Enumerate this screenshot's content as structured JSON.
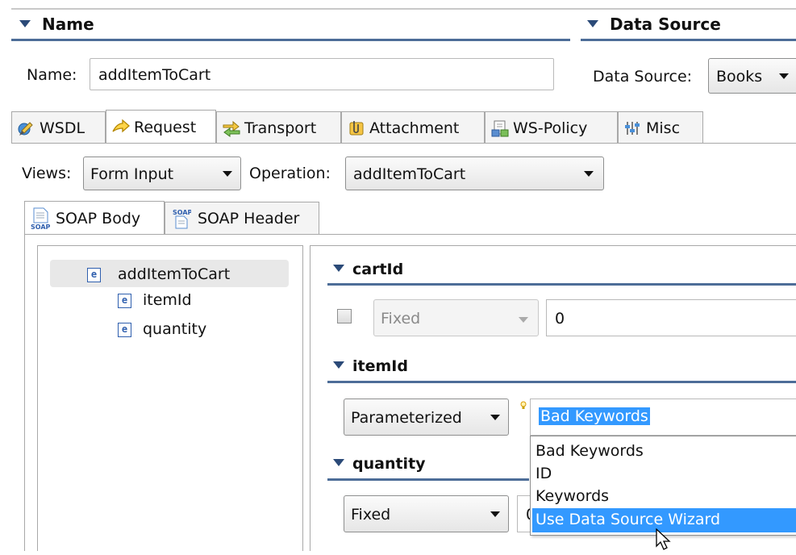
{
  "name_section": {
    "title": "Name",
    "label": "Name:",
    "value": "addItemToCart"
  },
  "datasource_section": {
    "title": "Data Source",
    "label": "Data Source:",
    "value": "Books"
  },
  "tabs": [
    {
      "label": "WSDL",
      "icon": "wsdl-icon"
    },
    {
      "label": "Request",
      "icon": "request-arrow-icon"
    },
    {
      "label": "Transport",
      "icon": "transport-icon"
    },
    {
      "label": "Attachment",
      "icon": "attachment-icon"
    },
    {
      "label": "WS-Policy",
      "icon": "ws-policy-icon"
    },
    {
      "label": "Misc",
      "icon": "misc-icon"
    }
  ],
  "views": {
    "label": "Views:",
    "value": "Form Input"
  },
  "operation": {
    "label": "Operation:",
    "value": "addItemToCart"
  },
  "subtabs": [
    {
      "label": "SOAP Body",
      "icon": "soap-body-icon"
    },
    {
      "label": "SOAP Header",
      "icon": "soap-header-icon"
    }
  ],
  "tree": {
    "root": "addItemToCart",
    "children": [
      "itemId",
      "quantity"
    ],
    "element_badge": "e"
  },
  "fields": {
    "cartId": {
      "title": "cartId",
      "mode": "Fixed",
      "value": "0"
    },
    "itemId": {
      "title": "itemId",
      "mode": "Parameterized",
      "value": "Bad Keywords"
    },
    "quantity": {
      "title": "quantity",
      "mode": "Fixed",
      "value_partial": "0"
    }
  },
  "dropdown": {
    "options": [
      "Bad Keywords",
      "ID",
      "Keywords",
      "Use Data Source Wizard"
    ],
    "highlighted": "Use Data Source Wizard"
  },
  "colors": {
    "section_line": "#4d6d98",
    "selection": "#3399ff",
    "tree_root_bg": "#e8e8e8",
    "element_badge": "#2f5fae"
  }
}
